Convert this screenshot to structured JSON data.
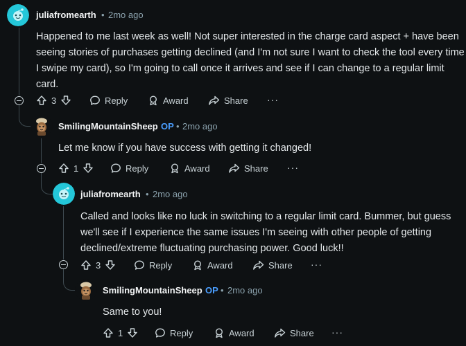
{
  "comments": [
    {
      "author": "juliafromearth",
      "time": "2mo ago",
      "op": "",
      "text": "Happened to me last week as well! Not super interested in the charge card aspect + have been seeing stories of purchases getting declined (and I'm not sure I want to check the tool every time I swipe my card), so I'm going to call once it arrives and see if I can change to a regular limit card.",
      "votes": "3"
    },
    {
      "author": "SmilingMountainSheep",
      "time": "2mo ago",
      "op": "OP",
      "text": "Let me know if you have success with getting it changed!",
      "votes": "1"
    },
    {
      "author": "juliafromearth",
      "time": "2mo ago",
      "op": "",
      "text": "Called and looks like no luck in switching to a regular limit card. Bummer, but guess we'll see if I experience the same issues I'm seeing with other people of getting declined/extreme fluctuating purchasing power. Good luck!!",
      "votes": "3"
    },
    {
      "author": "SmilingMountainSheep",
      "time": "2mo ago",
      "op": "OP",
      "text": "Same to you!",
      "votes": "1"
    }
  ],
  "actions": {
    "reply": "Reply",
    "award": "Award",
    "share": "Share",
    "more": "···"
  },
  "separator": "•",
  "colors": {
    "background": "#0e1113",
    "op_badge": "#4a9eff",
    "avatar_teal": "#24c7d9",
    "meta_text": "#8ba2ad"
  }
}
